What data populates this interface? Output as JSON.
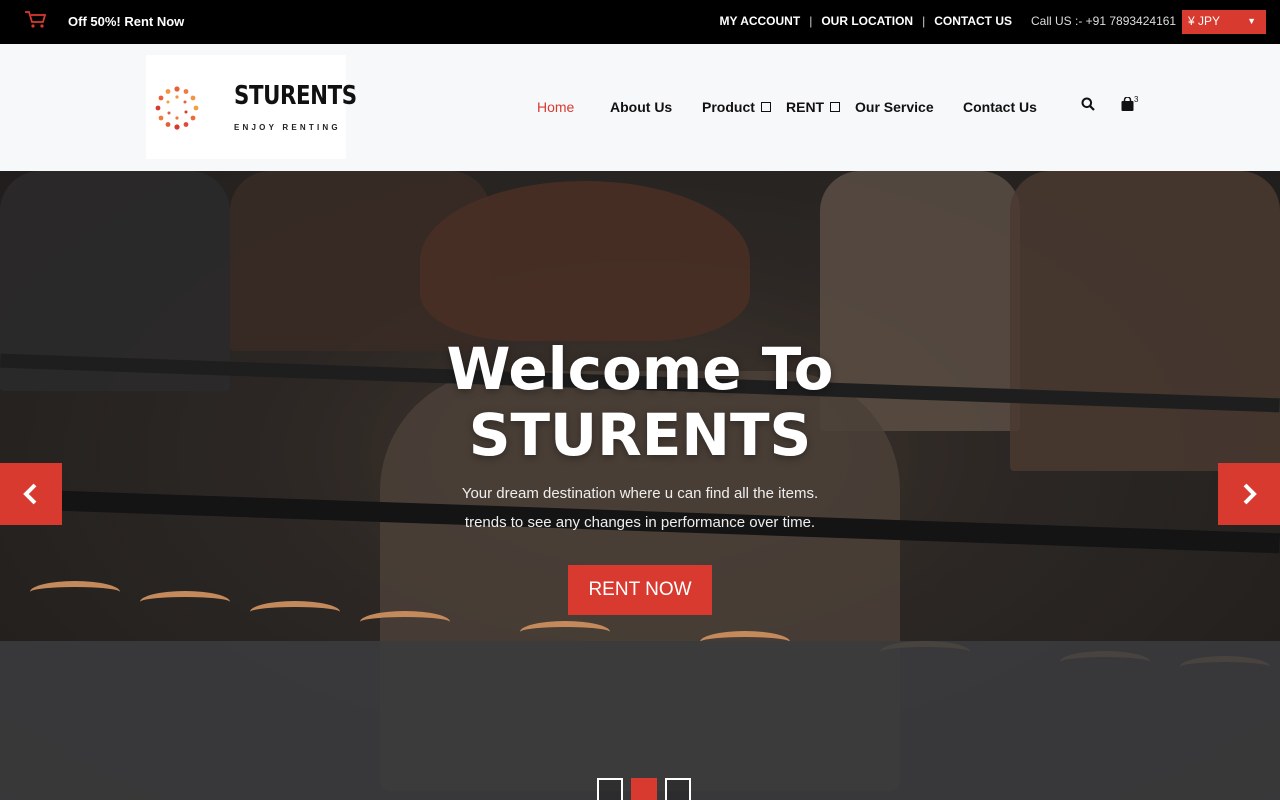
{
  "topbar": {
    "promo": "Off 50%! Rent Now",
    "links": [
      "MY ACCOUNT",
      "OUR LOCATION",
      "CONTACT US"
    ],
    "separator": "|",
    "phone": "Call US :- +91 7893424161",
    "currency": "¥ JPY"
  },
  "header": {
    "brand": "STURENTS",
    "tagline": "ENJOY RENTING",
    "nav": {
      "home": "Home",
      "about": "About Us",
      "product": "Product",
      "rent": "RENT",
      "service": "Our Service",
      "contact": "Contact Us"
    },
    "cart_count": "3"
  },
  "hero": {
    "title_line1": "Welcome To",
    "title_line2": "STURENTS",
    "subtitle_line1": "Your dream destination where u can find all the items.",
    "subtitle_line2": "trends to see any changes in performance over time.",
    "cta": "RENT NOW",
    "slides": 3,
    "active_slide": 2
  },
  "colors": {
    "accent": "#d93a30",
    "topbar_bg": "#000000",
    "header_bg": "#f7f8fa"
  }
}
